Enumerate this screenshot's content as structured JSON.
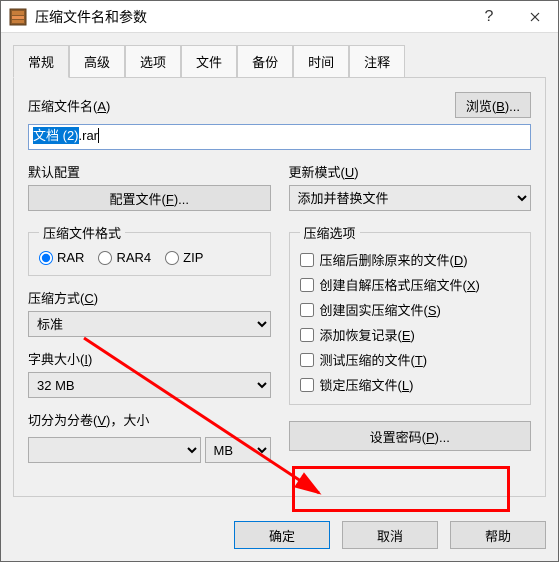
{
  "window": {
    "title": "压缩文件名和参数"
  },
  "tabs": [
    "常规",
    "高级",
    "选项",
    "文件",
    "备份",
    "时间",
    "注释"
  ],
  "filename": {
    "label": "压缩文件名(",
    "mnemonic": "A",
    "label_end": ")",
    "value_selected": "文档 (2)",
    "value_rest": ".rar ",
    "browse_label": "浏览(",
    "browse_mnemonic": "B",
    "browse_end": ")..."
  },
  "profile": {
    "label": "默认配置",
    "button": "配置文件(",
    "mnemonic": "F",
    "button_end": ")..."
  },
  "update": {
    "label": "更新模式(",
    "mnemonic": "U",
    "label_end": ")",
    "value": "添加并替换文件"
  },
  "format": {
    "legend": "压缩文件格式",
    "options": [
      "RAR",
      "RAR4",
      "ZIP"
    ]
  },
  "method": {
    "label": "压缩方式(",
    "mnemonic": "C",
    "label_end": ")",
    "value": "标准"
  },
  "dict": {
    "label": "字典大小(",
    "mnemonic": "I",
    "label_end": ")",
    "value": "32 MB"
  },
  "split": {
    "label": "切分为分卷(",
    "mnemonic": "V",
    "label_end": ")，大小",
    "unit": "MB"
  },
  "options": {
    "legend": "压缩选项",
    "items": [
      {
        "text": "压缩后删除原来的文件(",
        "m": "D",
        "end": ")"
      },
      {
        "text": "创建自解压格式压缩文件(",
        "m": "X",
        "end": ")"
      },
      {
        "text": "创建固实压缩文件(",
        "m": "S",
        "end": ")"
      },
      {
        "text": "添加恢复记录(",
        "m": "E",
        "end": ")"
      },
      {
        "text": "测试压缩的文件(",
        "m": "T",
        "end": ")"
      },
      {
        "text": "锁定压缩文件(",
        "m": "L",
        "end": ")"
      }
    ]
  },
  "password": {
    "label": "设置密码(",
    "mnemonic": "P",
    "label_end": ")..."
  },
  "footer": {
    "ok": "确定",
    "cancel": "取消",
    "help": "帮助"
  },
  "annotation": {
    "color": "#ff0000"
  }
}
